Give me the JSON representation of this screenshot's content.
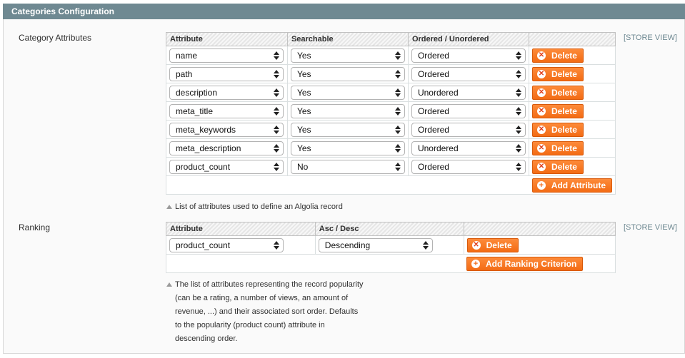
{
  "section": {
    "title": "Categories Configuration"
  },
  "category_attributes": {
    "label": "Category Attributes",
    "scope": "[STORE VIEW]",
    "columns": [
      "Attribute",
      "Searchable",
      "Ordered / Unordered",
      ""
    ],
    "rows": [
      {
        "attribute": "name",
        "searchable": "Yes",
        "order": "Ordered",
        "delete_label": "Delete"
      },
      {
        "attribute": "path",
        "searchable": "Yes",
        "order": "Ordered",
        "delete_label": "Delete"
      },
      {
        "attribute": "description",
        "searchable": "Yes",
        "order": "Unordered",
        "delete_label": "Delete"
      },
      {
        "attribute": "meta_title",
        "searchable": "Yes",
        "order": "Ordered",
        "delete_label": "Delete"
      },
      {
        "attribute": "meta_keywords",
        "searchable": "Yes",
        "order": "Ordered",
        "delete_label": "Delete"
      },
      {
        "attribute": "meta_description",
        "searchable": "Yes",
        "order": "Unordered",
        "delete_label": "Delete"
      },
      {
        "attribute": "product_count",
        "searchable": "No",
        "order": "Ordered",
        "delete_label": "Delete"
      }
    ],
    "add_label": "Add Attribute",
    "note": "List of attributes used to define an Algolia record"
  },
  "ranking": {
    "label": "Ranking",
    "scope": "[STORE VIEW]",
    "columns": [
      "Attribute",
      "Asc / Desc",
      ""
    ],
    "rows": [
      {
        "attribute": "product_count",
        "direction": "Descending",
        "delete_label": "Delete"
      }
    ],
    "add_label": "Add Ranking Criterion",
    "note_lines": [
      "The list of attributes representing the record popularity",
      "(can be a rating, a number of views, an amount of",
      "revenue, ...) and their associated sort order. Defaults",
      "to the popularity (product count) attribute in",
      "descending order."
    ]
  },
  "icons": {
    "delete": "delete-circle-x-icon",
    "add": "add-circle-plus-icon",
    "select": "select-arrows-icon"
  },
  "colors": {
    "header": "#6f8992",
    "button": "#f36b14",
    "scope": "#6f8992"
  }
}
